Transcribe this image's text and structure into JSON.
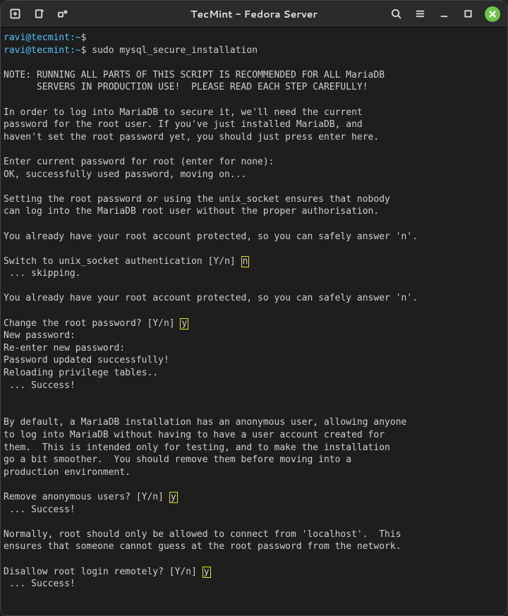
{
  "titlebar": {
    "title": "TecMint - Fedora Server"
  },
  "prompt": {
    "user_host": "ravi@tecmint",
    "sep": ":",
    "cwd": "~",
    "sym": "$"
  },
  "command": "sudo mysql_secure_installation",
  "answers": {
    "unix_socket": "n",
    "change_root": "y",
    "remove_anon": "y",
    "disallow_remote": "y"
  },
  "out": {
    "l1": "NOTE: RUNNING ALL PARTS OF THIS SCRIPT IS RECOMMENDED FOR ALL MariaDB",
    "l2": "      SERVERS IN PRODUCTION USE!  PLEASE READ EACH STEP CAREFULLY!",
    "l3": "In order to log into MariaDB to secure it, we'll need the current",
    "l4": "password for the root user. If you've just installed MariaDB, and",
    "l5": "haven't set the root password yet, you should just press enter here.",
    "l6": "Enter current password for root (enter for none):",
    "l7": "OK, successfully used password, moving on...",
    "l8": "Setting the root password or using the unix_socket ensures that nobody",
    "l9": "can log into the MariaDB root user without the proper authorisation.",
    "l10": "You already have your root account protected, so you can safely answer 'n'.",
    "l11a": "Switch to unix_socket authentication [Y/n] ",
    "l12": " ... skipping.",
    "l13": "You already have your root account protected, so you can safely answer 'n'.",
    "l14a": "Change the root password? [Y/n] ",
    "l15": "New password:",
    "l16": "Re-enter new password:",
    "l17": "Password updated successfully!",
    "l18": "Reloading privilege tables..",
    "l19": " ... Success!",
    "l20": "By default, a MariaDB installation has an anonymous user, allowing anyone",
    "l21": "to log into MariaDB without having to have a user account created for",
    "l22": "them.  This is intended only for testing, and to make the installation",
    "l23": "go a bit smoother.  You should remove them before moving into a",
    "l24": "production environment.",
    "l25a": "Remove anonymous users? [Y/n] ",
    "l26": " ... Success!",
    "l27": "Normally, root should only be allowed to connect from 'localhost'.  This",
    "l28": "ensures that someone cannot guess at the root password from the network.",
    "l29a": "Disallow root login remotely? [Y/n] ",
    "l30": " ... Success!"
  }
}
